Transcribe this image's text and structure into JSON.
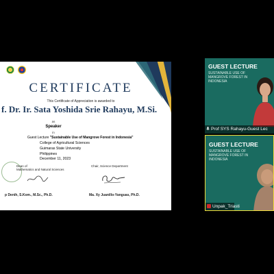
{
  "certificate": {
    "title": "CERTIFICATE",
    "awarded_text": "This Certificate of Appreciation is awarded to",
    "recipient": "f. Dr. Ir. Sata Yoshida Srie Rahayu, M.Si.",
    "as_text": "as",
    "role": "Speaker",
    "in_text": "in",
    "lecture_prefix": "Guest Lecture ",
    "lecture_title": "\"Sustainable Use of Mangrove Forest in Indonesia\"",
    "college": "College of Agricultural Sciences",
    "university": "Guimaras State University",
    "country": "Philippines",
    "date": "December 11, 2023",
    "dean_label_1": "Dean of",
    "dean_label_2": "Mathematics and Natural Sciences",
    "chair_label": "Chair, Science Department",
    "dean_name": "p Denih, S.Kom., M.Sc., Ph.D.",
    "chair_name": "Ma. Xy Juanillo-Yanguas, Ph.D."
  },
  "tiles": [
    {
      "heading": "GUEST LECTURE",
      "subheading": "SUSTAINABLE USE OF MANGROVE FOREST IN INDONESIA",
      "name_label": "Prof SYS Rahayu-Guest Lec"
    },
    {
      "heading": "GUEST LECTURE",
      "subheading": "SUSTAINABLE USE OF MANGROVE FOREST IN INDONESIA",
      "name_label": "Unpak_Triasti"
    }
  ],
  "colors": {
    "navy": "#1f3a5c",
    "gold": "#e3b53b",
    "tile_bg": "#1a6b60",
    "active_speaker_border": "#f0dc3a"
  }
}
